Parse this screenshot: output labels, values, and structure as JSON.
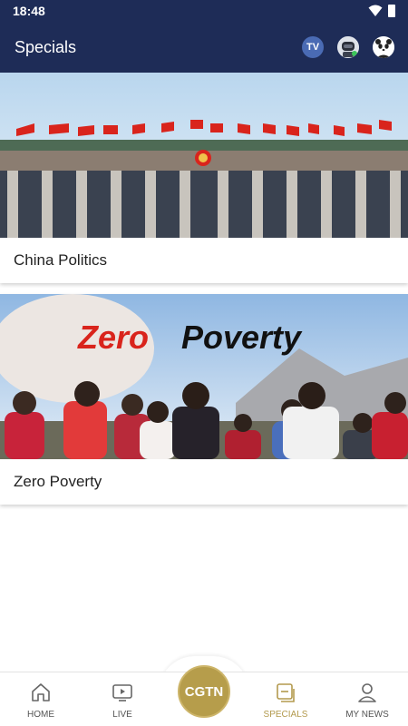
{
  "status": {
    "time": "18:48"
  },
  "appbar": {
    "title": "Specials",
    "tv_label": "TV"
  },
  "cards": [
    {
      "title": "China Politics"
    },
    {
      "title": "Zero Poverty",
      "banner_text_1": "Zero",
      "banner_text_2": "Poverty"
    }
  ],
  "nav": {
    "items": [
      {
        "label": "HOME",
        "icon": "home-icon"
      },
      {
        "label": "LIVE",
        "icon": "play-icon"
      },
      {
        "label": "SPECIALS",
        "icon": "specials-icon",
        "active": true
      },
      {
        "label": "MY NEWS",
        "icon": "person-icon"
      }
    ],
    "center_label": "CGTN"
  },
  "colors": {
    "appbar": "#1e2c57",
    "accent": "#b69d4b",
    "flag_red": "#d9241c"
  }
}
